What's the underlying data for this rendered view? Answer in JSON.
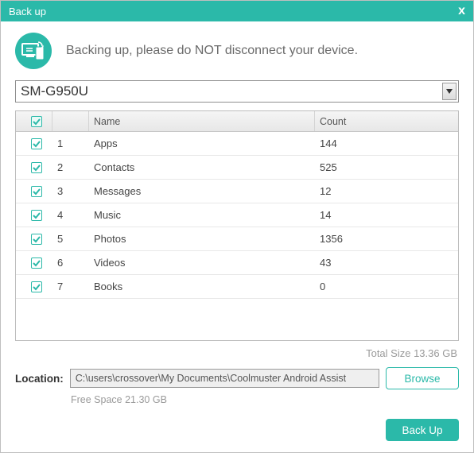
{
  "window": {
    "title": "Back up",
    "close_glyph": "x"
  },
  "banner": {
    "message": "Backing up, please do NOT disconnect your device."
  },
  "device": {
    "selected": "SM-G950U"
  },
  "grid": {
    "headers": {
      "name": "Name",
      "count": "Count"
    },
    "rows": [
      {
        "idx": "1",
        "name": "Apps",
        "count": "144"
      },
      {
        "idx": "2",
        "name": "Contacts",
        "count": "525"
      },
      {
        "idx": "3",
        "name": "Messages",
        "count": "12"
      },
      {
        "idx": "4",
        "name": "Music",
        "count": "14"
      },
      {
        "idx": "5",
        "name": "Photos",
        "count": "1356"
      },
      {
        "idx": "6",
        "name": "Videos",
        "count": "43"
      },
      {
        "idx": "7",
        "name": "Books",
        "count": "0"
      }
    ]
  },
  "totals": {
    "text": "Total Size 13.36 GB"
  },
  "location": {
    "label": "Location:",
    "path": "C:\\users\\crossover\\My Documents\\Coolmuster Android Assist",
    "free_space": "Free Space 21.30 GB"
  },
  "buttons": {
    "browse": "Browse",
    "backup": "Back Up"
  }
}
